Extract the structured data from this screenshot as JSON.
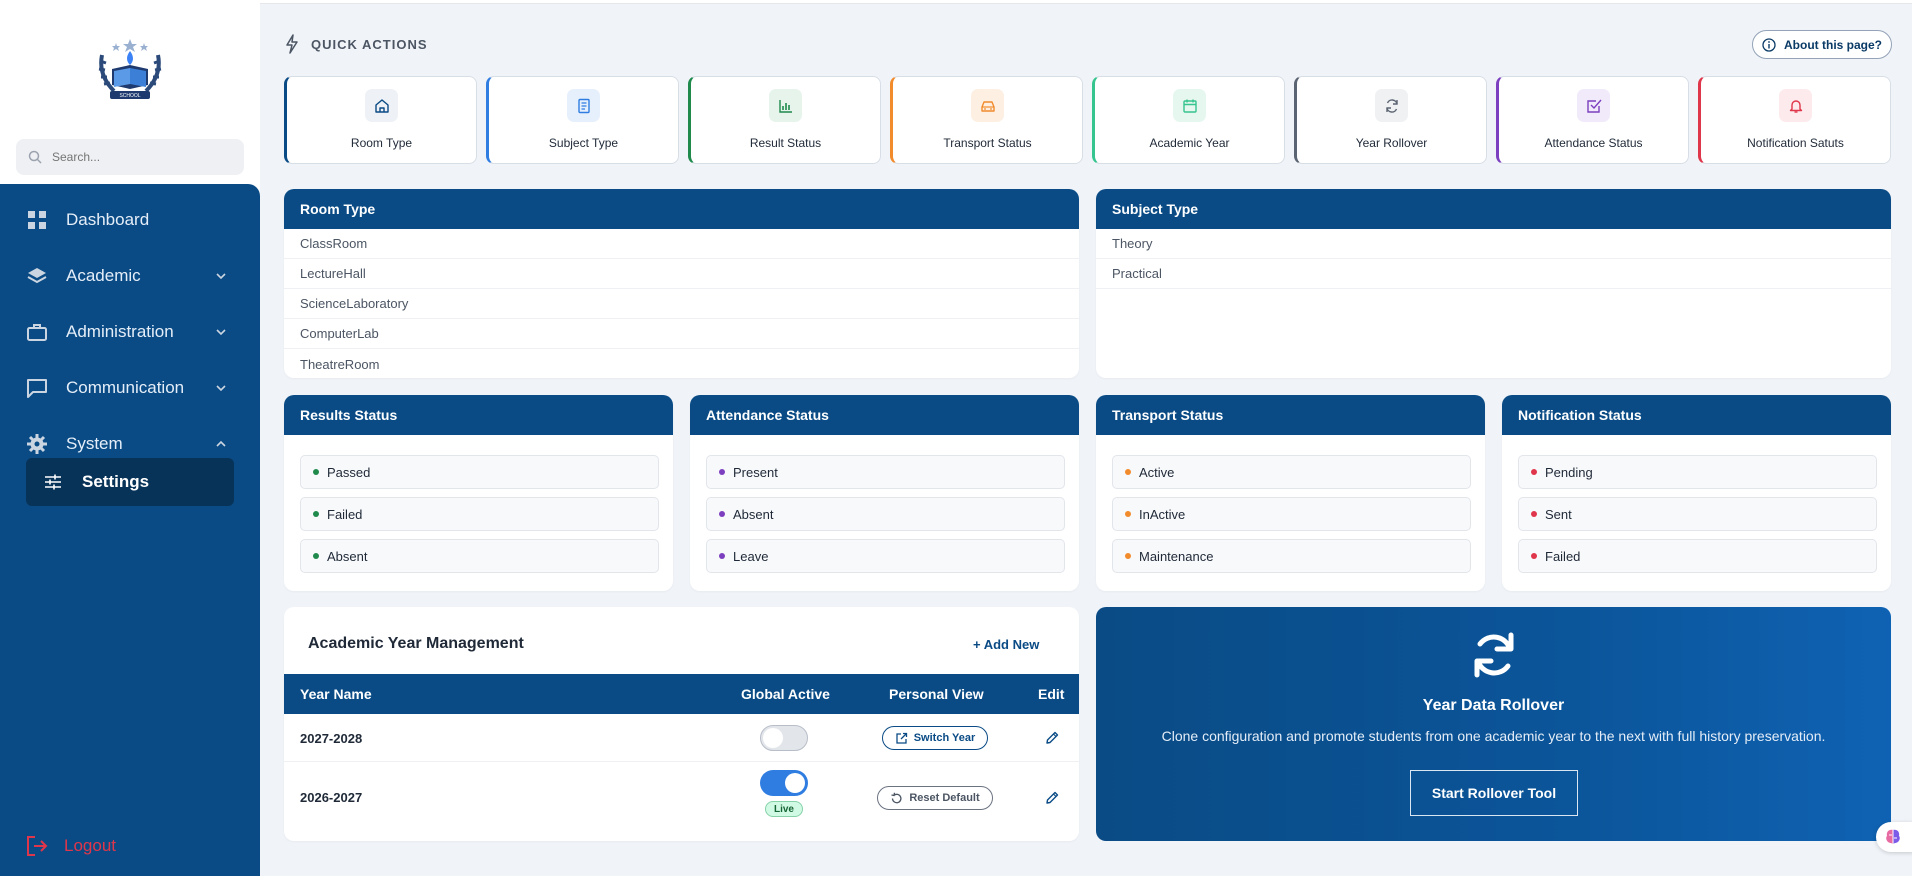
{
  "sidebar": {
    "search_placeholder": "Search...",
    "items": [
      {
        "label": "Dashboard",
        "icon": "grid-icon"
      },
      {
        "label": "Academic",
        "icon": "layers-icon"
      },
      {
        "label": "Administration",
        "icon": "briefcase-icon"
      },
      {
        "label": "Communication",
        "icon": "chat-icon"
      },
      {
        "label": "System",
        "icon": "gear-icon"
      }
    ],
    "active_subitem": "Settings",
    "logout": "Logout"
  },
  "quick_actions": {
    "title": "QUICK ACTIONS",
    "about": "About this page?",
    "cards": [
      {
        "label": "Room Type",
        "accent": "#0a4b85",
        "icon": "home-icon"
      },
      {
        "label": "Subject Type",
        "accent": "#2f7de1",
        "icon": "document-icon"
      },
      {
        "label": "Result Status",
        "accent": "#1f8a4c",
        "icon": "bar-chart-icon"
      },
      {
        "label": "Transport Status",
        "accent": "#f28b2c",
        "icon": "car-icon"
      },
      {
        "label": "Academic Year",
        "accent": "#36c48f",
        "icon": "calendar-icon"
      },
      {
        "label": "Year Rollover",
        "accent": "#5b6472",
        "icon": "refresh-icon"
      },
      {
        "label": "Attendance Status",
        "accent": "#7c3fbf",
        "icon": "check-square-icon"
      },
      {
        "label": "Notification Satuts",
        "accent": "#e0364b",
        "icon": "bell-icon"
      }
    ]
  },
  "room_type": {
    "title": "Room Type",
    "items": [
      "ClassRoom",
      "LectureHall",
      "ScienceLaboratory",
      "ComputerLab",
      "TheatreRoom"
    ]
  },
  "subject_type": {
    "title": "Subject Type",
    "items": [
      "Theory",
      "Practical"
    ]
  },
  "results_status": {
    "title": "Results Status",
    "dot_color": "#1f8a4c",
    "items": [
      "Passed",
      "Failed",
      "Absent"
    ]
  },
  "attendance_status": {
    "title": "Attendance Status",
    "dot_color": "#7c3fbf",
    "items": [
      "Present",
      "Absent",
      "Leave"
    ]
  },
  "transport_status": {
    "title": "Transport Status",
    "dot_color": "#f28b2c",
    "items": [
      "Active",
      "InActive",
      "Maintenance"
    ]
  },
  "notification_status": {
    "title": "Notification Status",
    "dot_color": "#e0364b",
    "items": [
      "Pending",
      "Sent",
      "Failed"
    ]
  },
  "academic_year": {
    "title": "Academic Year Management",
    "add_new": "+ Add New",
    "columns": [
      "Year Name",
      "Global Active",
      "Personal View",
      "Edit"
    ],
    "rows": [
      {
        "name": "2027-2028",
        "active": false,
        "action": "Switch Year"
      },
      {
        "name": "2026-2027",
        "active": true,
        "badge": "Live",
        "action": "Reset Default"
      }
    ]
  },
  "rollover": {
    "title": "Year Data Rollover",
    "description": "Clone configuration and promote students from one academic year to the next with full history preservation.",
    "button": "Start Rollover Tool"
  }
}
